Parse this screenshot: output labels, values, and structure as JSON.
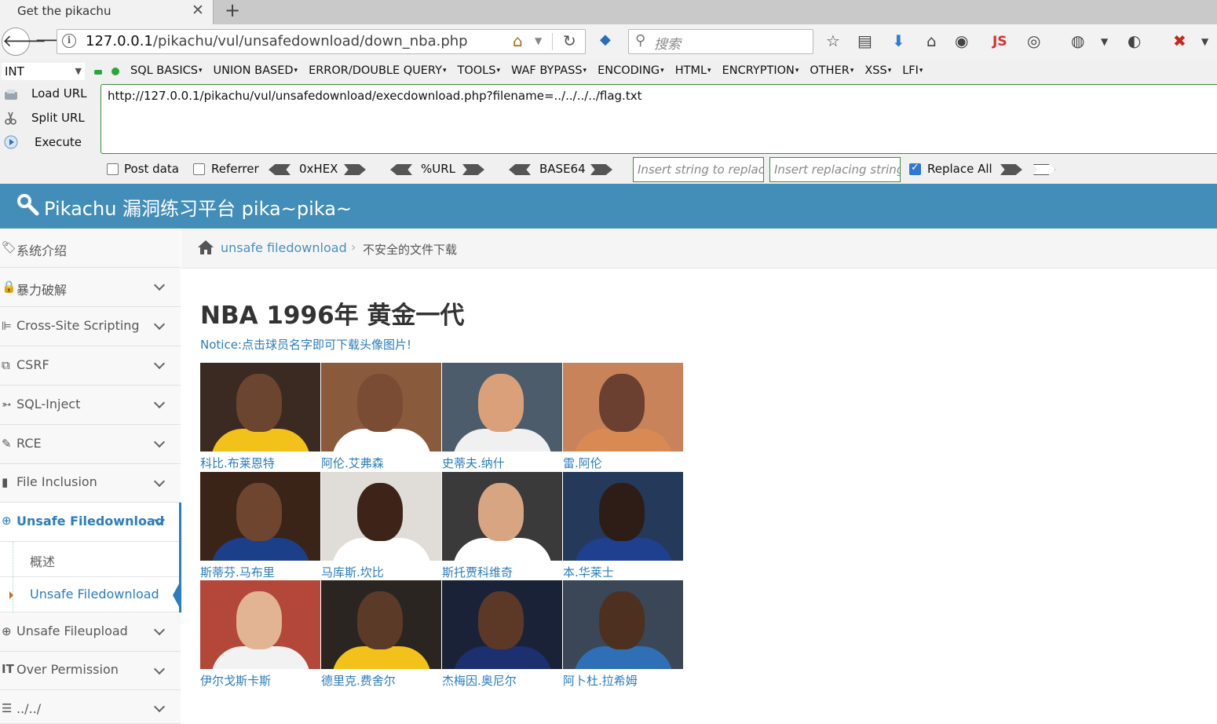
{
  "browser": {
    "tab_title": "Get the pikachu",
    "url_host": "127.0.0.1",
    "url_path": "/pikachu/vul/unsafedownload/down_nba.php",
    "search_placeholder": "搜索",
    "js_label": "JS"
  },
  "hackbar": {
    "type_select": "INT",
    "menus": [
      "SQL BASICS",
      "UNION BASED",
      "ERROR/DOUBLE QUERY",
      "TOOLS",
      "WAF BYPASS",
      "ENCODING",
      "HTML",
      "ENCRYPTION",
      "OTHER",
      "XSS",
      "LFI"
    ],
    "load_url": "Load URL",
    "split_url": "Split URL",
    "execute": "Execute",
    "url_value": "http://127.0.0.1/pikachu/vul/unsafedownload/execdownload.php?filename=../../../../flag.txt",
    "post_data": "Post data",
    "referrer": "Referrer",
    "hex": "0xHEX",
    "urlenc": "%URL",
    "base64": "BASE64",
    "replace_placeholder": "Insert string to replace",
    "replacing_placeholder": "Insert replacing string",
    "replace_all": "Replace All"
  },
  "site": {
    "title": "Pikachu 漏洞练习平台 pika~pika~",
    "accent": "#438eb9"
  },
  "sidebar": {
    "items": [
      {
        "label": "系统介绍"
      },
      {
        "label": "暴力破解"
      },
      {
        "label": "Cross-Site Scripting"
      },
      {
        "label": "CSRF"
      },
      {
        "label": "SQL-Inject"
      },
      {
        "label": "RCE"
      },
      {
        "label": "File Inclusion"
      },
      {
        "label": "Unsafe Filedownload"
      },
      {
        "label": "Unsafe Fileupload"
      },
      {
        "label": "Over Permission"
      },
      {
        "label": "../../"
      }
    ],
    "sub_items": [
      {
        "label": "概述"
      },
      {
        "label": "Unsafe Filedownload"
      }
    ]
  },
  "breadcrumb": {
    "link": "unsafe filedownload",
    "current": "不安全的文件下载"
  },
  "main": {
    "title": "NBA 1996年 黄金一代",
    "notice": "Notice:点击球员名字即可下载头像图片!",
    "players": [
      {
        "name": "科比.布莱恩特",
        "jersey": "#f3c21a",
        "bg": "#3b2a22",
        "skin": "#6b4530"
      },
      {
        "name": "阿伦.艾弗森",
        "jersey": "#ffffff",
        "bg": "#8a5a3d",
        "skin": "#7a4c33"
      },
      {
        "name": "史蒂夫.纳什",
        "jersey": "#f0f0f0",
        "bg": "#4c5c6a",
        "skin": "#d9a07a"
      },
      {
        "name": "雷.阿伦",
        "jersey": "#d98a52",
        "bg": "#c9835a",
        "skin": "#6b4030"
      },
      {
        "name": "斯蒂芬.马布里",
        "jersey": "#1c3f8a",
        "bg": "#3a2418",
        "skin": "#6e4630"
      },
      {
        "name": "马库斯.坎比",
        "jersey": "#ffffff",
        "bg": "#e0ddd8",
        "skin": "#3e2418"
      },
      {
        "name": "斯托贾科维奇",
        "jersey": "#ffffff",
        "bg": "#3a3a3a",
        "skin": "#d8a583"
      },
      {
        "name": "本.华莱士",
        "jersey": "#1f3f8f",
        "bg": "#253a5a",
        "skin": "#2e1d17"
      },
      {
        "name": "伊尔戈斯卡斯",
        "jersey": "#f2f2f2",
        "bg": "#b2473a",
        "skin": "#e2b493"
      },
      {
        "name": "德里克.费舍尔",
        "jersey": "#f3c21a",
        "bg": "#2a2520",
        "skin": "#5b3a28"
      },
      {
        "name": "杰梅因.奥尼尔",
        "jersey": "#1c2f6e",
        "bg": "#1a2238",
        "skin": "#5c3826"
      },
      {
        "name": "阿卜杜.拉希姆",
        "jersey": "#2f6fb5",
        "bg": "#3b4656",
        "skin": "#4e3020"
      }
    ]
  }
}
